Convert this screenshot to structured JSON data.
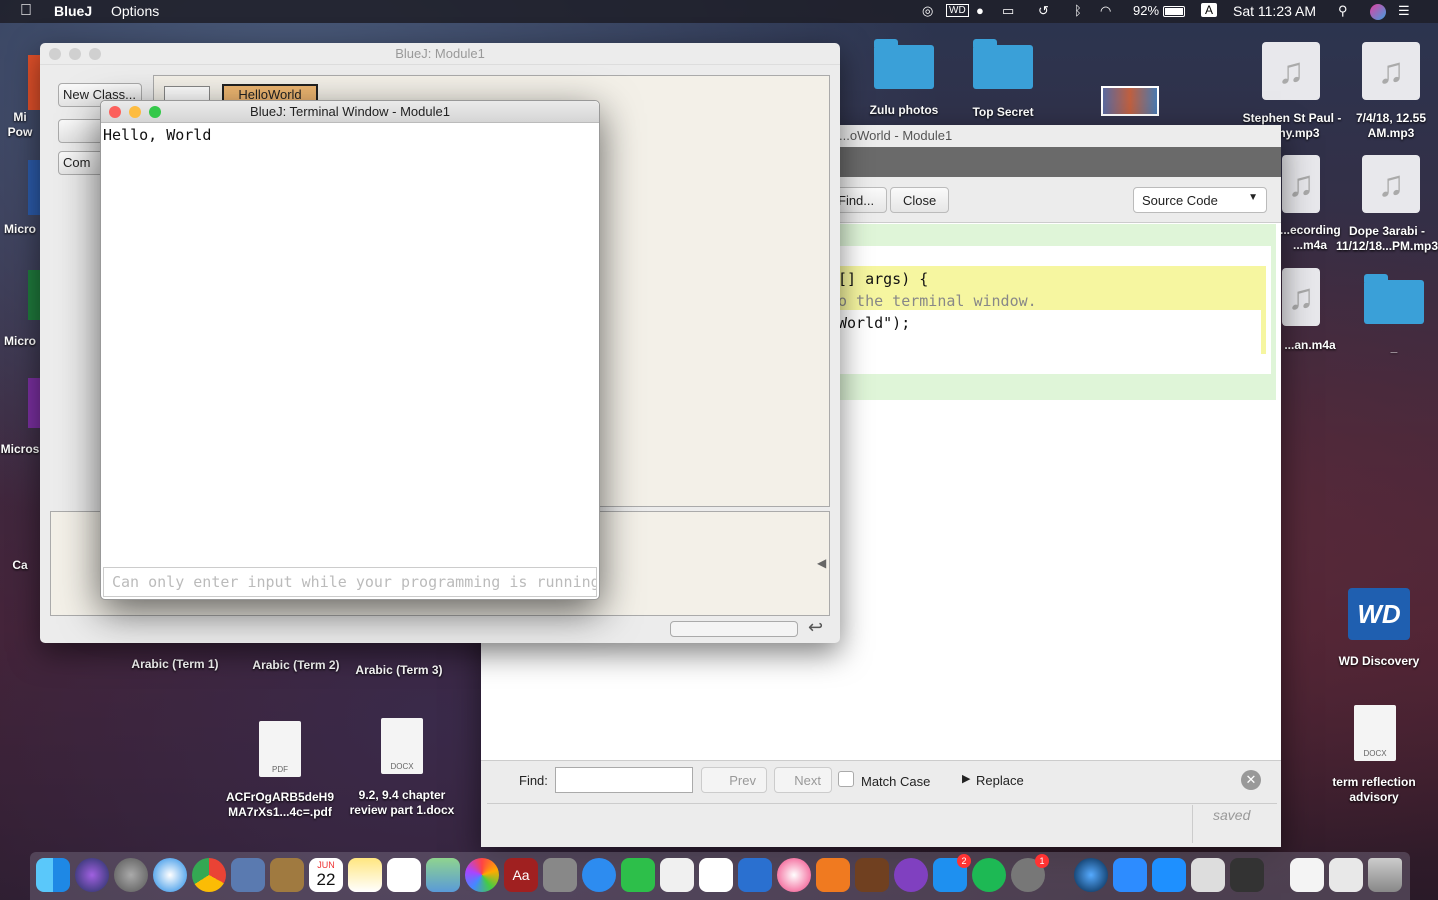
{
  "menubar": {
    "app_name": "BlueJ",
    "options": "Options",
    "battery": "92%",
    "input_source": "A",
    "clock": "Sat 11:23 AM"
  },
  "desktop": {
    "left_partial": [
      "Mi Pow",
      "Micro",
      "Micro",
      "Micros",
      "Ca"
    ],
    "folders": [
      {
        "label": "Zulu photos"
      },
      {
        "label": "Top Secret"
      }
    ],
    "files": [
      {
        "label": "Stephen St Paul - ...thy.mp3"
      },
      {
        "label": "7/4/18, 12.55 AM.mp3"
      },
      {
        "label": "...ecording ...m4a"
      },
      {
        "label": "Dope 3arabi - 11/12/18...PM.mp3"
      },
      {
        "label": "...an.m4a"
      },
      {
        "label": "_"
      },
      {
        "label": "Arabic (Term 1)"
      },
      {
        "label": "Arabic (Term 2)"
      },
      {
        "label": "Arabic (Term 3)"
      },
      {
        "label": "ACFrOgARB5deH9 MA7rXs1...4c=.pdf",
        "badge": "PDF"
      },
      {
        "label": "9.2, 9.4 chapter review part 1.docx",
        "badge": "DOCX"
      },
      {
        "label": "WD Discovery"
      },
      {
        "label": "term reflection advisory",
        "badge": "DOCX"
      }
    ],
    "wd_logo": "WD"
  },
  "main_window": {
    "title": "BlueJ:  Module1",
    "new_class": "New Class...",
    "compile": "Com",
    "class_name": "HelloWorld"
  },
  "editor_window": {
    "title": "...oWorld - Module1",
    "find_button": "Find...",
    "close_button": "Close",
    "view_select": "Source Code",
    "code_lines": [
      "[] args) {",
      "o the terminal window.",
      " World\");"
    ],
    "find_label": "Find:",
    "prev": "Prev",
    "next": "Next",
    "match_case": "Match Case",
    "replace": "Replace",
    "status": "saved"
  },
  "terminal_window": {
    "title": "BlueJ: Terminal Window - Module1",
    "output": "Hello, World",
    "input_placeholder": "Can only enter input while your programming is running"
  },
  "dock": {
    "calendar_day": "22",
    "calendar_month": "JUN",
    "appstore_badge": "2",
    "prefs_badge": "1"
  }
}
